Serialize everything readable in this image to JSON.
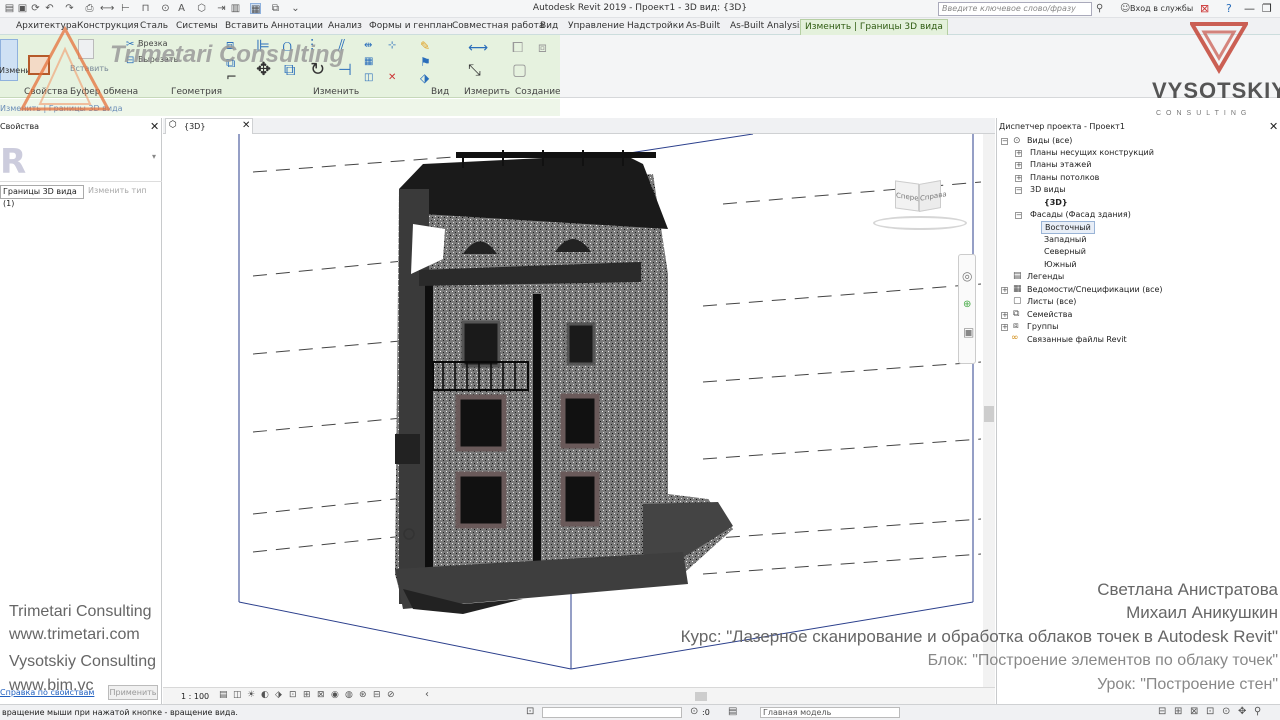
{
  "app": {
    "title": "Autodesk Revit 2019 - Проект1 - 3D вид: {3D}",
    "search_placeholder": "Введите ключевое слово/фразу",
    "login": "Вход в службы"
  },
  "tabs": [
    "Архитектура",
    "Конструкция",
    "Сталь",
    "Системы",
    "Вставить",
    "Аннотации",
    "Анализ",
    "Формы и генплан",
    "Совместная работа",
    "Вид",
    "Управление",
    "Надстройки",
    "As-Built",
    "As-Built Analysis",
    "Изменить | Границы 3D вида"
  ],
  "ribbon": {
    "panels": [
      "Свойства",
      "Буфер обмена",
      "Геометрия",
      "Изменить",
      "Вид",
      "Измерить",
      "Создание"
    ],
    "cut_label": "Врезка",
    "join_label": "Вырезать",
    "context_label": "Изменить | Границы 3D вида",
    "modify_label": "Изменить",
    "paste_label": "Вставить"
  },
  "properties": {
    "title": "Свойства",
    "type_selector": "Границы 3D вида (1)",
    "edit_type": "Изменить тип",
    "help_link": "Справка по свойствам",
    "apply": "Применить"
  },
  "view": {
    "tab_label": "{3D}",
    "scale": "1 : 100",
    "cube_left": "Спереди",
    "cube_right": "Справа"
  },
  "browser": {
    "title": "Диспетчер проекта - Проект1",
    "items": [
      {
        "label": "Виды (все)"
      },
      {
        "label": "Планы несущих конструкций"
      },
      {
        "label": "Планы этажей"
      },
      {
        "label": "Планы потолков"
      },
      {
        "label": "3D виды"
      },
      {
        "label": "{3D}"
      },
      {
        "label": "Фасады (Фасад здания)"
      },
      {
        "label": "Восточный"
      },
      {
        "label": "Западный"
      },
      {
        "label": "Северный"
      },
      {
        "label": "Южный"
      },
      {
        "label": "Легенды"
      },
      {
        "label": "Ведомости/Спецификации (все)"
      },
      {
        "label": "Листы (все)"
      },
      {
        "label": "Семейства"
      },
      {
        "label": "Группы"
      },
      {
        "label": "Связанные файлы Revit"
      }
    ]
  },
  "status": {
    "text": "вращение мыши при нажатой кнопке - вращение вида.",
    "model": "Главная модель",
    "count": ":0"
  },
  "watermarks": {
    "trimetari_logo": "Trimetari Consulting",
    "vysotskiy_logo": "VYSOTSKIY",
    "vysotskiy_sub": "CONSULTING",
    "left_lines": [
      "Trimetari Consulting",
      "www.trimetari.com",
      "Vysotskiy Consulting",
      "www.bim.vc"
    ],
    "right_lines": [
      "Светлана Анистратова",
      "Михаил Аникушкин",
      "Курс: \"Лазерное сканирование и обработка облаков точек в Autodesk Revit\"",
      "Блок: \"Построение элементов по облаку точек\"",
      "Урок: \"Построение стен\""
    ]
  }
}
